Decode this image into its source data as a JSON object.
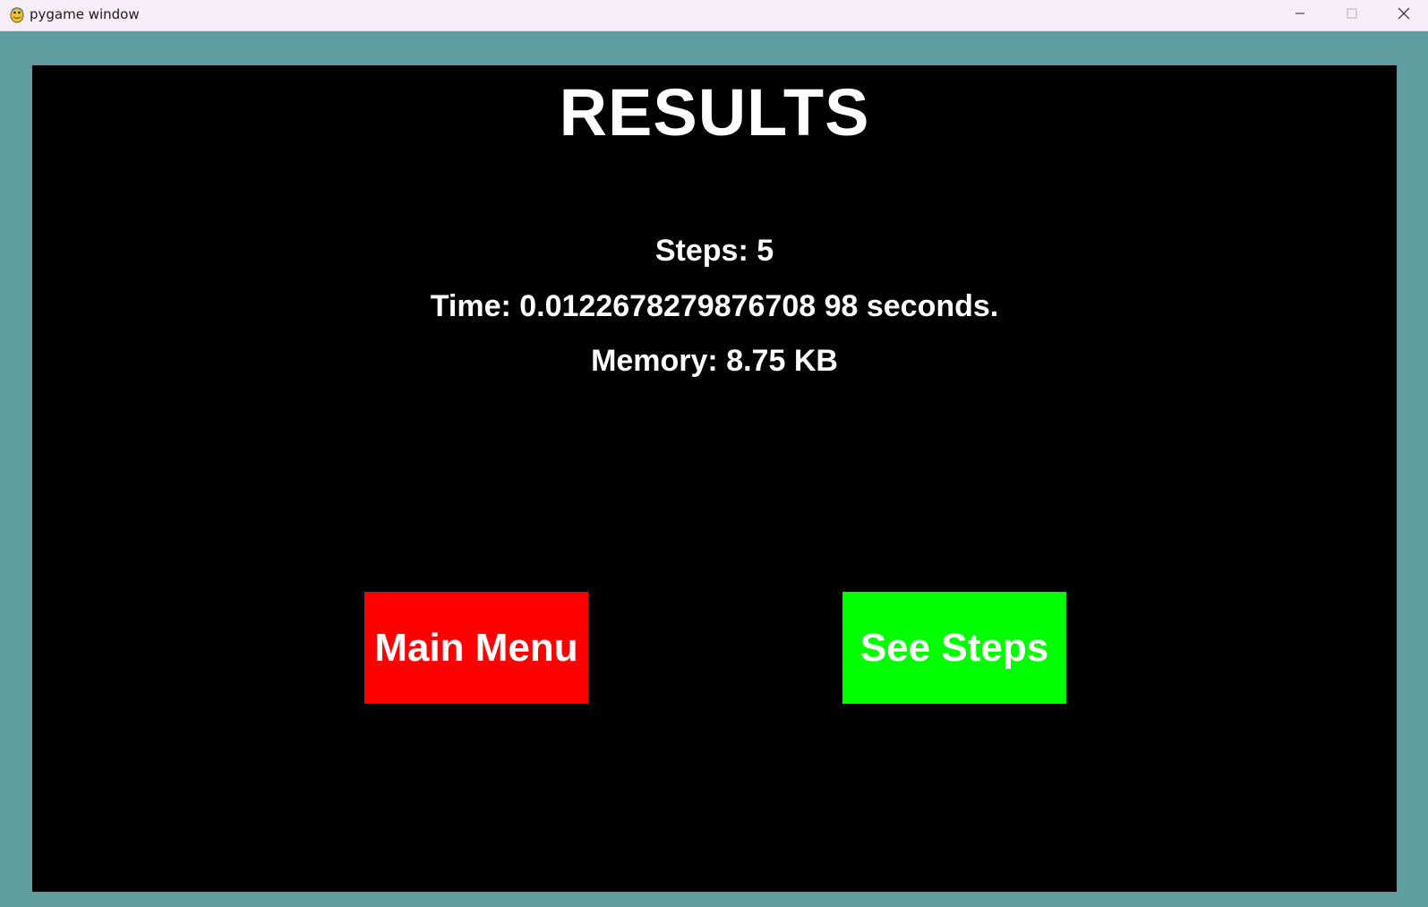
{
  "window": {
    "title": "pygame window",
    "app_icon": "pygame-snake-icon",
    "controls": {
      "minimize_icon": "minimize-icon",
      "maximize_icon": "maximize-icon",
      "close_icon": "close-icon"
    }
  },
  "colors": {
    "window_background": "#5f9ea0",
    "surface_background": "#000000",
    "text": "#ffffff",
    "main_menu_button": "#ff0000",
    "see_steps_button": "#00ff00"
  },
  "results": {
    "title": "RESULTS",
    "steps": "Steps: 5",
    "time": "Time: 0.0122678279876708 98 seconds.",
    "memory": "Memory: 8.75 KB"
  },
  "buttons": {
    "main_menu": "Main Menu",
    "see_steps": "See Steps"
  }
}
